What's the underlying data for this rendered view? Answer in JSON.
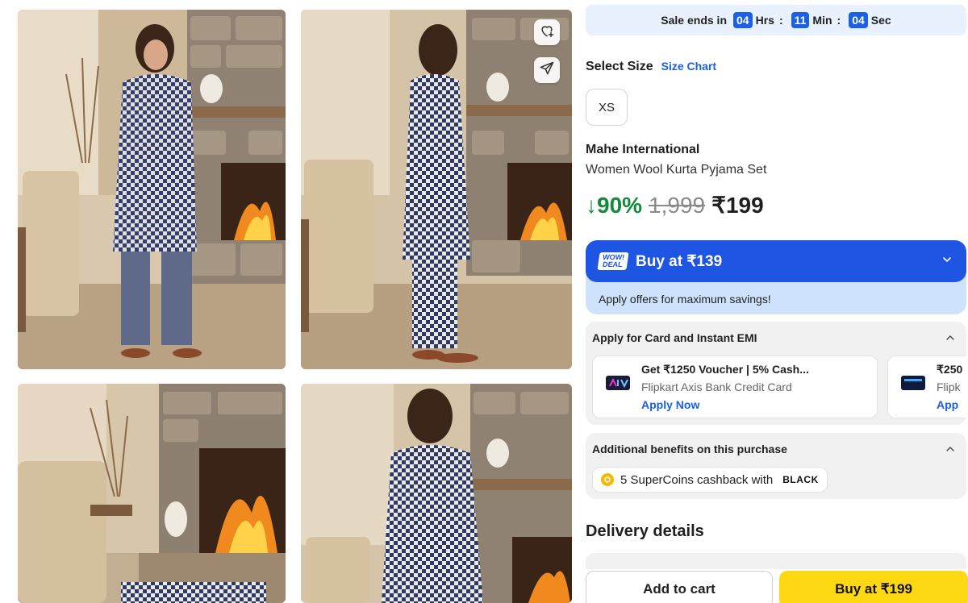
{
  "gallery": {
    "photos": [
      "photo-front",
      "photo-side",
      "photo-room",
      "photo-back"
    ]
  },
  "actions": {
    "wishlist_icon": "heart-plus-icon",
    "share_icon": "send-icon"
  },
  "sale": {
    "prefix": "Sale ends in",
    "hours": "04",
    "hours_unit": "Hrs",
    "minutes": "11",
    "minutes_unit": "Min",
    "seconds": "04",
    "seconds_unit": "Sec",
    "separator": ":"
  },
  "size": {
    "title": "Select Size",
    "chart_link": "Size Chart",
    "options": [
      "XS"
    ]
  },
  "product": {
    "brand": "Mahe International",
    "title": "Women Wool Kurta Pyjama Set",
    "discount": "↓90%",
    "mrp": "1,999",
    "price": "₹199"
  },
  "wow_deal": {
    "badge_line1": "WOW!",
    "badge_line2": "DEAL",
    "label": "Buy at ₹139",
    "subtitle": "Apply offers for maximum savings!"
  },
  "emi": {
    "heading": "Apply for Card and Instant EMI",
    "offers": [
      {
        "title": "Get ₹1250 Voucher | 5% Cash...",
        "subtitle": "Flipkart Axis Bank Credit Card",
        "cta": "Apply Now"
      },
      {
        "title": "₹250",
        "subtitle": "Flipk",
        "cta": "App"
      }
    ]
  },
  "benefits": {
    "heading": "Additional benefits on this purchase",
    "coin_text": "5 SuperCoins cashback with",
    "tag": "BLACK"
  },
  "delivery": {
    "title": "Delivery details"
  },
  "bottom": {
    "add_to_cart": "Add to cart",
    "buy": "Buy at ₹199"
  },
  "colors": {
    "accent": "#1b60e5",
    "wow": "#1f55e3",
    "discount": "#138a3b",
    "buy_button": "#ffd814"
  }
}
